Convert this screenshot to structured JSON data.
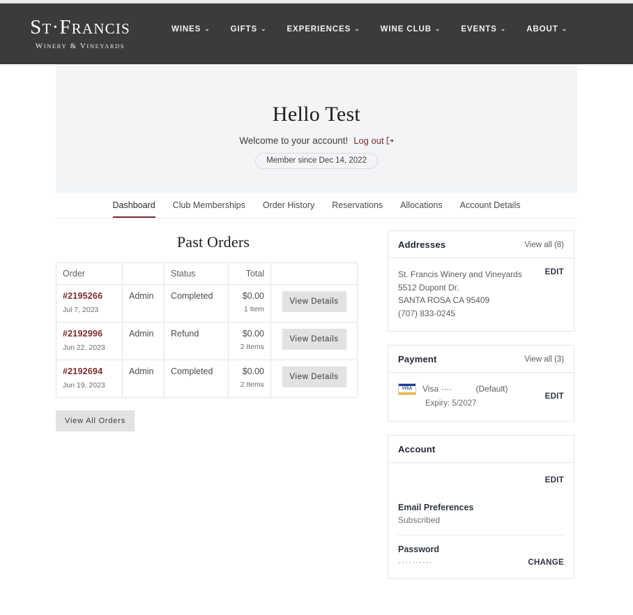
{
  "header": {
    "logo_main": "St·Francis",
    "logo_sub": "Winery & Vineyards",
    "nav": [
      {
        "label": "WINES",
        "caret": "chevron-down"
      },
      {
        "label": "GIFTS",
        "caret": "chevron-down"
      },
      {
        "label": "EXPERIENCES",
        "caret": "chevron-down"
      },
      {
        "label": "WINE CLUB",
        "caret": "chevron-down"
      },
      {
        "label": "EVENTS",
        "caret": "chevron-down"
      },
      {
        "label": "ABOUT",
        "caret": "chevron-down"
      }
    ]
  },
  "hero": {
    "greeting": "Hello Test",
    "welcome": "Welcome to your account!",
    "logout_label": "Log out",
    "member_since": "Member since Dec 14, 2022"
  },
  "tabs": [
    {
      "label": "Dashboard",
      "active": true
    },
    {
      "label": "Club Memberships",
      "active": false
    },
    {
      "label": "Order History",
      "active": false
    },
    {
      "label": "Reservations",
      "active": false
    },
    {
      "label": "Allocations",
      "active": false
    },
    {
      "label": "Account Details",
      "active": false
    }
  ],
  "orders": {
    "title": "Past Orders",
    "columns": [
      "Order",
      "",
      "Status",
      "Total",
      ""
    ],
    "rows": [
      {
        "order_no": "#2195266",
        "date": "Jul 7, 2023",
        "source": "Admin",
        "status": "Completed",
        "total": "$0.00",
        "items": "1 Item",
        "action": "View Details"
      },
      {
        "order_no": "#2192996",
        "date": "Jun 22, 2023",
        "source": "Admin",
        "status": "Refund",
        "total": "$0.00",
        "items": "2 Items",
        "action": "View Details"
      },
      {
        "order_no": "#2192694",
        "date": "Jun 19, 2023",
        "source": "Admin",
        "status": "Completed",
        "total": "$0.00",
        "items": "2 Items",
        "action": "View Details"
      }
    ],
    "view_all_label": "View All Orders"
  },
  "addresses": {
    "title": "Addresses",
    "view_all": "View all (8)",
    "name": "St. Francis Winery and Vineyards",
    "street": "5512 Dupont Dr.",
    "city_state_zip": "SANTA ROSA CA 95409",
    "phone": "(707) 833-0245",
    "edit_label": "EDIT"
  },
  "payment": {
    "title": "Payment",
    "view_all": "View all (3)",
    "card_icon": "visa-card-icon",
    "card_label": "Visa ····",
    "default_label": "(Default)",
    "expiry": "Expiry: 5/2027",
    "edit_label": "EDIT"
  },
  "account": {
    "title": "Account",
    "edit_label": "EDIT",
    "email_pref_label": "Email Preferences",
    "email_pref_value": "Subscribed",
    "password_label": "Password",
    "password_masked": "··········",
    "change_label": "CHANGE"
  },
  "colors": {
    "header_bg": "#3b3b3b",
    "accent_maroon": "#7b2c2c",
    "hero_bg": "#f2f4f6",
    "button_grey": "#e2e2e2"
  }
}
